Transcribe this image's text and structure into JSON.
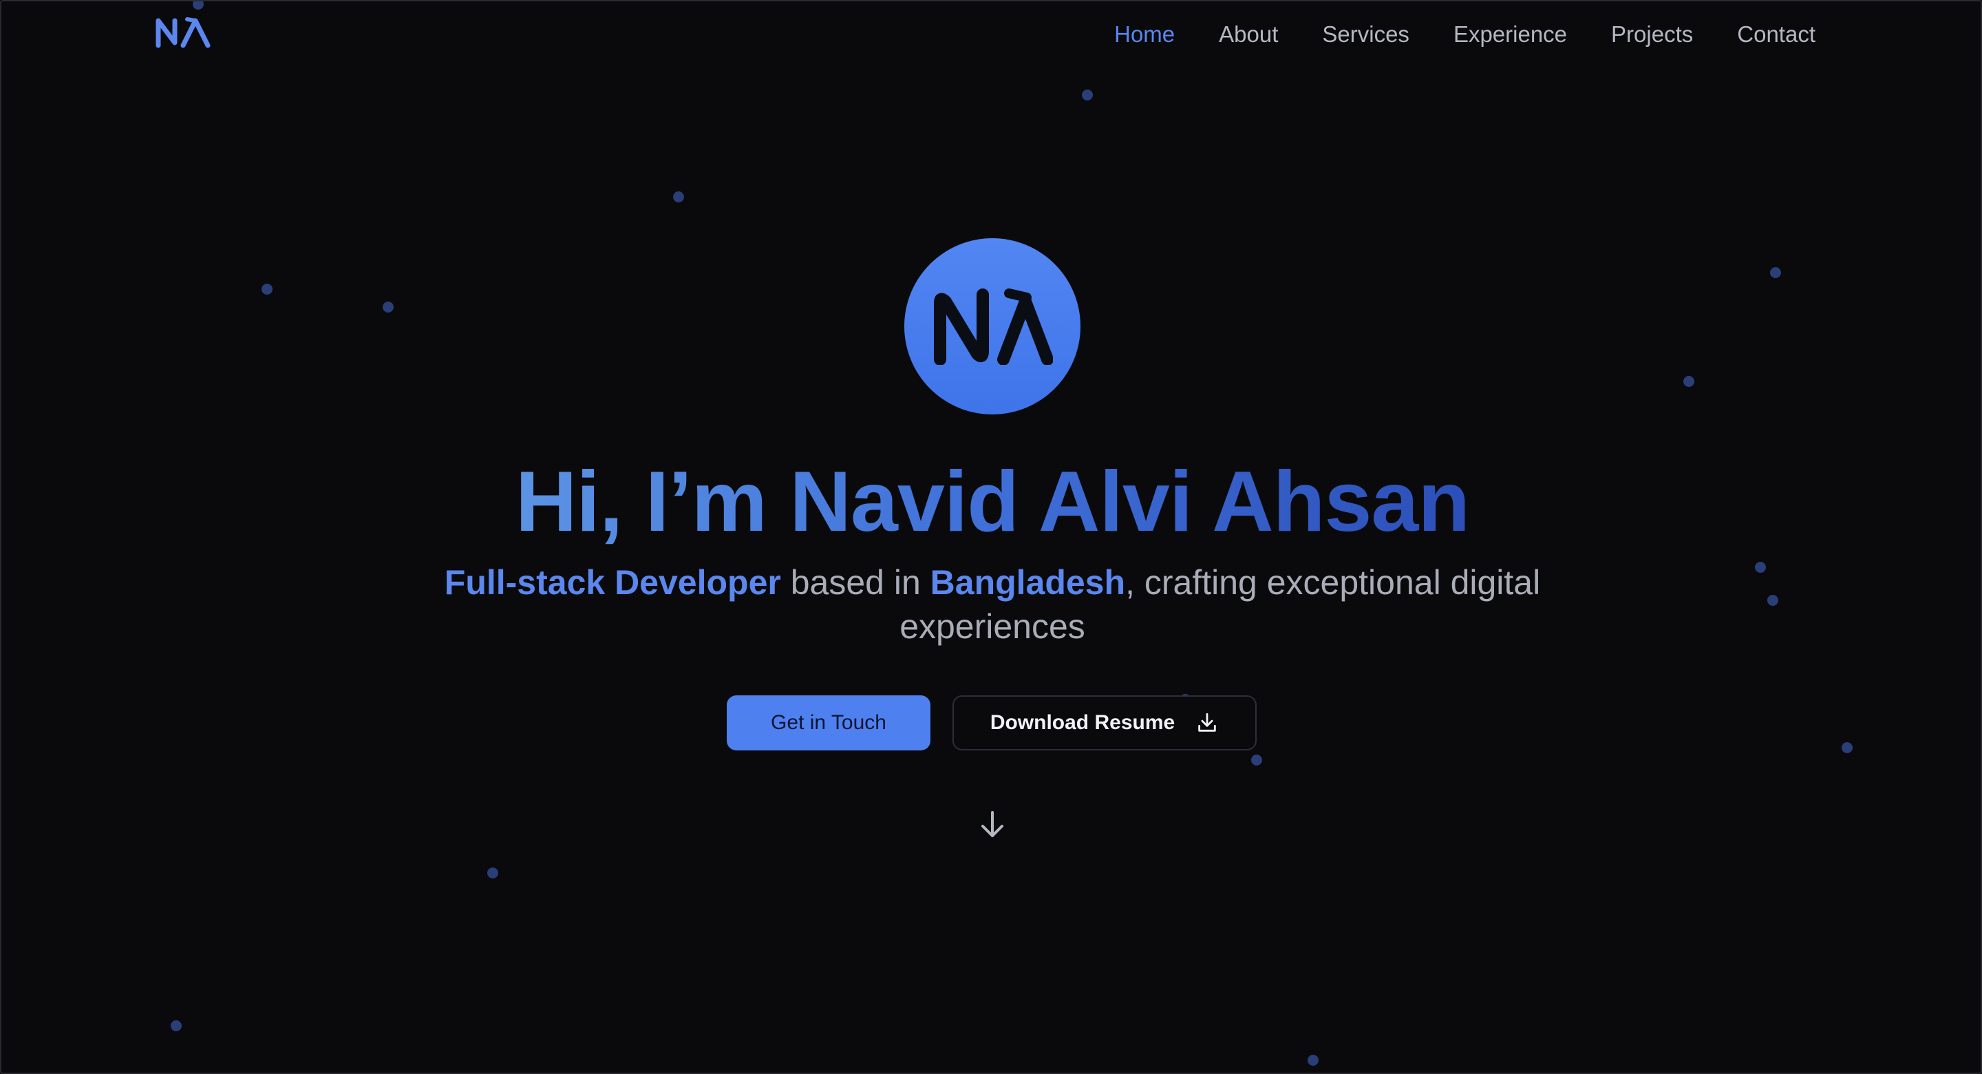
{
  "brand": {
    "logo_text": "NA",
    "accent": "#4f80ef"
  },
  "nav": {
    "items": [
      {
        "label": "Home",
        "active": true
      },
      {
        "label": "About",
        "active": false
      },
      {
        "label": "Services",
        "active": false
      },
      {
        "label": "Experience",
        "active": false
      },
      {
        "label": "Projects",
        "active": false
      },
      {
        "label": "Contact",
        "active": false
      }
    ]
  },
  "hero": {
    "title": "Hi, I’m Navid Alvi Ahsan",
    "subtitle": {
      "role": "Full-stack Developer",
      "mid": " based in ",
      "location": "Bangladesh",
      "tail": ", crafting exceptional digital experiences"
    },
    "primary_button": "Get in Touch",
    "secondary_button": "Download Resume",
    "icons": {
      "download": "download-icon",
      "scroll": "arrow-down-icon"
    }
  },
  "colors": {
    "background": "#0a0a0d",
    "nav_text": "#b4b8c2",
    "nav_active": "#5b87ee",
    "particle": "#2a3e78"
  }
}
